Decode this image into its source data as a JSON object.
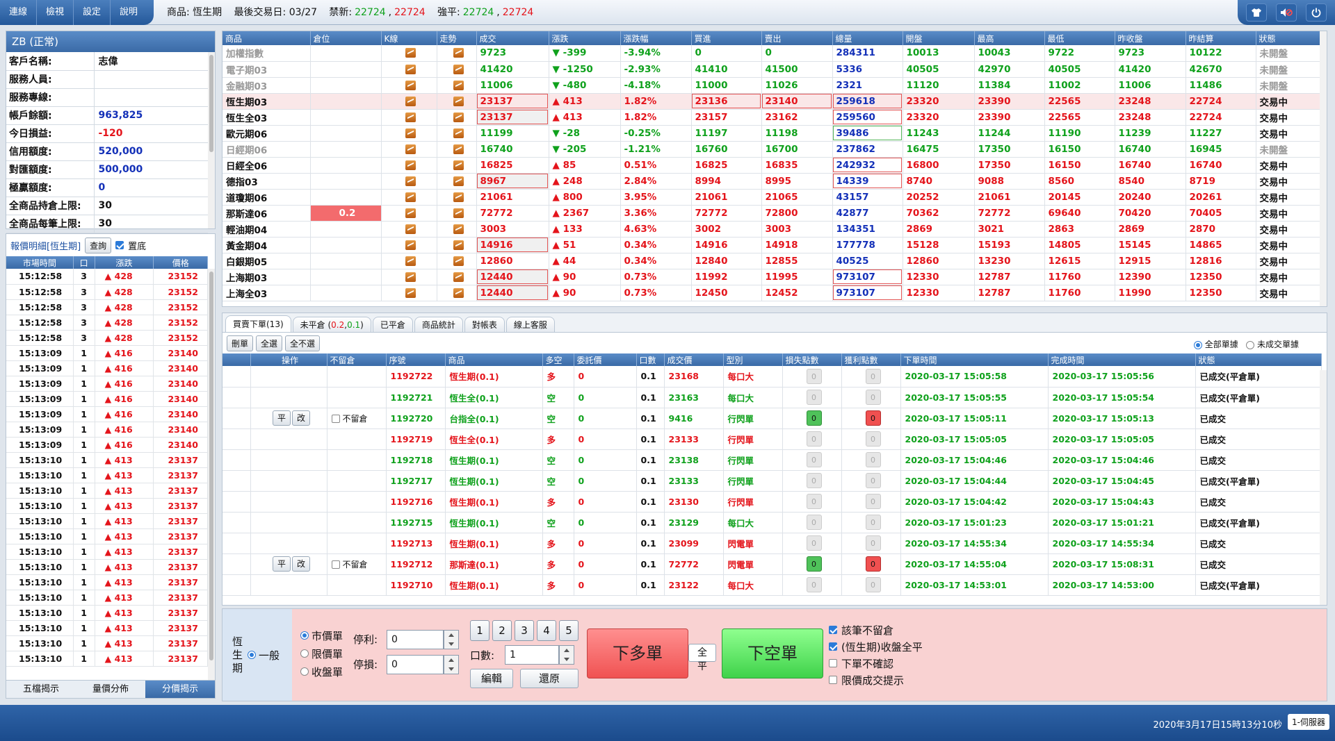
{
  "menu": [
    "連線",
    "檢視",
    "設定",
    "說明"
  ],
  "topinfo": {
    "product": "商品: 恆生期",
    "last_trade": "最後交易日: 03/27",
    "ban_label": "禁新:",
    "ban_buy": "22724",
    "ban_sell": "22724",
    "force_label": "強平:",
    "force_buy": "22724",
    "force_sell": "22724"
  },
  "account": {
    "title": "ZB (正常)",
    "rows": [
      {
        "label": "客戶名稱:",
        "value": "志偉",
        "color": "black"
      },
      {
        "label": "服務人員:",
        "value": "",
        "color": "black"
      },
      {
        "label": "服務專線:",
        "value": "",
        "color": "black"
      },
      {
        "label": "帳戶餘額:",
        "value": "963,825",
        "color": "blue"
      },
      {
        "label": "今日損益:",
        "value": "-120",
        "color": "red"
      },
      {
        "label": "信用額度:",
        "value": "520,000",
        "color": "blue"
      },
      {
        "label": "對匯額度:",
        "value": "500,000",
        "color": "blue"
      },
      {
        "label": "極贏額度:",
        "value": "0",
        "color": "blue"
      },
      {
        "label": "全商品持倉上限:",
        "value": "30",
        "color": "black"
      },
      {
        "label": "全商品每筆上限:",
        "value": "30",
        "color": "black"
      }
    ]
  },
  "tick": {
    "title": "報價明細[恆生期]",
    "query": "查詢",
    "pin": "置底",
    "headers": [
      "市場時間",
      "口",
      "漲跌",
      "價格"
    ],
    "rows": [
      [
        "15:12:58",
        "3",
        "428",
        "23152"
      ],
      [
        "15:12:58",
        "3",
        "428",
        "23152"
      ],
      [
        "15:12:58",
        "3",
        "428",
        "23152"
      ],
      [
        "15:12:58",
        "3",
        "428",
        "23152"
      ],
      [
        "15:12:58",
        "3",
        "428",
        "23152"
      ],
      [
        "15:13:09",
        "1",
        "416",
        "23140"
      ],
      [
        "15:13:09",
        "1",
        "416",
        "23140"
      ],
      [
        "15:13:09",
        "1",
        "416",
        "23140"
      ],
      [
        "15:13:09",
        "1",
        "416",
        "23140"
      ],
      [
        "15:13:09",
        "1",
        "416",
        "23140"
      ],
      [
        "15:13:09",
        "1",
        "416",
        "23140"
      ],
      [
        "15:13:09",
        "1",
        "416",
        "23140"
      ],
      [
        "15:13:10",
        "1",
        "413",
        "23137"
      ],
      [
        "15:13:10",
        "1",
        "413",
        "23137"
      ],
      [
        "15:13:10",
        "1",
        "413",
        "23137"
      ],
      [
        "15:13:10",
        "1",
        "413",
        "23137"
      ],
      [
        "15:13:10",
        "1",
        "413",
        "23137"
      ],
      [
        "15:13:10",
        "1",
        "413",
        "23137"
      ],
      [
        "15:13:10",
        "1",
        "413",
        "23137"
      ],
      [
        "15:13:10",
        "1",
        "413",
        "23137"
      ],
      [
        "15:13:10",
        "1",
        "413",
        "23137"
      ],
      [
        "15:13:10",
        "1",
        "413",
        "23137"
      ],
      [
        "15:13:10",
        "1",
        "413",
        "23137"
      ],
      [
        "15:13:10",
        "1",
        "413",
        "23137"
      ],
      [
        "15:13:10",
        "1",
        "413",
        "23137"
      ],
      [
        "15:13:10",
        "1",
        "413",
        "23137"
      ]
    ],
    "tabs": [
      "五檔揭示",
      "量價分佈",
      "分價揭示"
    ]
  },
  "quote": {
    "headers": [
      "商品",
      "倉位",
      "K線",
      "走勢",
      "成交",
      "漲跌",
      "漲跌幅",
      "買進",
      "賣出",
      "總量",
      "開盤",
      "最高",
      "最低",
      "昨收盤",
      "昨結算",
      "狀態"
    ],
    "rows": [
      {
        "name": "加權指數",
        "pos": "",
        "last": "9723",
        "chg": "-399",
        "pct": "-3.94%",
        "bid": "0",
        "ask": "0",
        "vol": "284311",
        "open": "10013",
        "high": "10043",
        "low": "9722",
        "prev": "9723",
        "settle": "10122",
        "status": "未開盤",
        "dir": "down",
        "active": false
      },
      {
        "name": "電子期03",
        "pos": "",
        "last": "41420",
        "chg": "-1250",
        "pct": "-2.93%",
        "bid": "41410",
        "ask": "41500",
        "vol": "5336",
        "open": "40505",
        "high": "42970",
        "low": "40505",
        "prev": "41420",
        "settle": "42670",
        "status": "未開盤",
        "dir": "down",
        "active": false
      },
      {
        "name": "金融期03",
        "pos": "",
        "last": "11006",
        "chg": "-480",
        "pct": "-4.18%",
        "bid": "11000",
        "ask": "11026",
        "vol": "2321",
        "open": "11120",
        "high": "11384",
        "low": "11002",
        "prev": "11006",
        "settle": "11486",
        "status": "未開盤",
        "dir": "down",
        "active": false
      },
      {
        "name": "恆生期03",
        "pos": "",
        "last": "23137",
        "chg": "413",
        "pct": "1.82%",
        "bid": "23136",
        "ask": "23140",
        "vol": "259618",
        "open": "23320",
        "high": "23390",
        "low": "22565",
        "prev": "23248",
        "settle": "22724",
        "status": "交易中",
        "dir": "up",
        "active": true
      },
      {
        "name": "恆生全03",
        "pos": "",
        "last": "23137",
        "chg": "413",
        "pct": "1.82%",
        "bid": "23157",
        "ask": "23162",
        "vol": "259560",
        "open": "23320",
        "high": "23390",
        "low": "22565",
        "prev": "23248",
        "settle": "22724",
        "status": "交易中",
        "dir": "up",
        "active": true
      },
      {
        "name": "歐元期06",
        "pos": "",
        "last": "11199",
        "chg": "-28",
        "pct": "-0.25%",
        "bid": "11197",
        "ask": "11198",
        "vol": "39486",
        "open": "11243",
        "high": "11244",
        "low": "11190",
        "prev": "11239",
        "settle": "11227",
        "status": "交易中",
        "dir": "down",
        "active": true
      },
      {
        "name": "日經期06",
        "pos": "",
        "last": "16740",
        "chg": "-205",
        "pct": "-1.21%",
        "bid": "16760",
        "ask": "16700",
        "vol": "237862",
        "open": "16475",
        "high": "17350",
        "low": "16150",
        "prev": "16740",
        "settle": "16945",
        "status": "未開盤",
        "dir": "down",
        "active": false
      },
      {
        "name": "日經全06",
        "pos": "",
        "last": "16825",
        "chg": "85",
        "pct": "0.51%",
        "bid": "16825",
        "ask": "16835",
        "vol": "242932",
        "open": "16800",
        "high": "17350",
        "low": "16150",
        "prev": "16740",
        "settle": "16740",
        "status": "交易中",
        "dir": "up",
        "active": true
      },
      {
        "name": "德指03",
        "pos": "",
        "last": "8967",
        "chg": "248",
        "pct": "2.84%",
        "bid": "8994",
        "ask": "8995",
        "vol": "14339",
        "open": "8740",
        "high": "9088",
        "low": "8560",
        "prev": "8540",
        "settle": "8719",
        "status": "交易中",
        "dir": "up",
        "active": true
      },
      {
        "name": "道瓊期06",
        "pos": "",
        "last": "21061",
        "chg": "800",
        "pct": "3.95%",
        "bid": "21061",
        "ask": "21065",
        "vol": "43157",
        "open": "20252",
        "high": "21061",
        "low": "20145",
        "prev": "20240",
        "settle": "20261",
        "status": "交易中",
        "dir": "up",
        "active": true
      },
      {
        "name": "那斯達06",
        "pos": "0.2",
        "last": "72772",
        "chg": "2367",
        "pct": "3.36%",
        "bid": "72772",
        "ask": "72800",
        "vol": "42877",
        "open": "70362",
        "high": "72772",
        "low": "69640",
        "prev": "70420",
        "settle": "70405",
        "status": "交易中",
        "dir": "up",
        "active": true
      },
      {
        "name": "輕油期04",
        "pos": "",
        "last": "3003",
        "chg": "133",
        "pct": "4.63%",
        "bid": "3002",
        "ask": "3003",
        "vol": "134351",
        "open": "2869",
        "high": "3021",
        "low": "2863",
        "prev": "2869",
        "settle": "2870",
        "status": "交易中",
        "dir": "up",
        "active": true
      },
      {
        "name": "黃金期04",
        "pos": "",
        "last": "14916",
        "chg": "51",
        "pct": "0.34%",
        "bid": "14916",
        "ask": "14918",
        "vol": "177778",
        "open": "15128",
        "high": "15193",
        "low": "14805",
        "prev": "15145",
        "settle": "14865",
        "status": "交易中",
        "dir": "up",
        "active": true
      },
      {
        "name": "白銀期05",
        "pos": "",
        "last": "12860",
        "chg": "44",
        "pct": "0.34%",
        "bid": "12840",
        "ask": "12855",
        "vol": "40525",
        "open": "12860",
        "high": "13230",
        "low": "12615",
        "prev": "12915",
        "settle": "12816",
        "status": "交易中",
        "dir": "up",
        "active": true
      },
      {
        "name": "上海期03",
        "pos": "",
        "last": "12440",
        "chg": "90",
        "pct": "0.73%",
        "bid": "11992",
        "ask": "11995",
        "vol": "973107",
        "open": "12330",
        "high": "12787",
        "low": "11760",
        "prev": "12390",
        "settle": "12350",
        "status": "交易中",
        "dir": "up",
        "active": true
      },
      {
        "name": "上海全03",
        "pos": "",
        "last": "12440",
        "chg": "90",
        "pct": "0.73%",
        "bid": "12450",
        "ask": "12452",
        "vol": "973107",
        "open": "12330",
        "high": "12787",
        "low": "11760",
        "prev": "11990",
        "settle": "12350",
        "status": "交易中",
        "dir": "up",
        "active": true
      }
    ]
  },
  "orders": {
    "tabs": [
      "買賣下單(13)",
      "未平倉 (0.2,0.1)",
      "已平倉",
      "商品統計",
      "對帳表",
      "線上客服"
    ],
    "unpos_prefix": "未平倉 (",
    "unpos_a": "0.2",
    "unpos_b": "0.1",
    "buttons": [
      "刪單",
      "全選",
      "全不選"
    ],
    "filter_all": "全部單據",
    "filter_open": "未成交單據",
    "headers": [
      "操作",
      "不留倉",
      "序號",
      "商品",
      "多空",
      "委託價",
      "口數",
      "成交價",
      "型別",
      "損失點數",
      "獲利點數",
      "下單時間",
      "完成時間",
      "狀態"
    ],
    "btn_close": "平",
    "btn_edit": "改",
    "noholdlbl": "不留倉",
    "rows": [
      {
        "ops": false,
        "id": "1192722",
        "prod": "恆生期(0.1)",
        "side": "多",
        "price": "0",
        "qty": "0.1",
        "fill": "23168",
        "type": "每口大",
        "loss": "0",
        "profit": "0",
        "t1": "2020-03-17 15:05:58",
        "t2": "2020-03-17 15:05:56",
        "status": "已成交(平倉單)",
        "color": "red",
        "lc": "g",
        "pc": "g"
      },
      {
        "ops": false,
        "id": "1192721",
        "prod": "恆生全(0.1)",
        "side": "空",
        "price": "0",
        "qty": "0.1",
        "fill": "23163",
        "type": "每口大",
        "loss": "0",
        "profit": "0",
        "t1": "2020-03-17 15:05:55",
        "t2": "2020-03-17 15:05:54",
        "status": "已成交(平倉單)",
        "color": "green",
        "lc": "g",
        "pc": "g"
      },
      {
        "ops": true,
        "id": "1192720",
        "prod": "台指全(0.1)",
        "side": "空",
        "price": "0",
        "qty": "0.1",
        "fill": "9416",
        "type": "行閃單",
        "loss": "0",
        "profit": "0",
        "t1": "2020-03-17 15:05:11",
        "t2": "2020-03-17 15:05:13",
        "status": "已成交",
        "color": "green",
        "lc": "gr",
        "pc": "rd"
      },
      {
        "ops": false,
        "id": "1192719",
        "prod": "恆生全(0.1)",
        "side": "多",
        "price": "0",
        "qty": "0.1",
        "fill": "23133",
        "type": "行閃單",
        "loss": "0",
        "profit": "0",
        "t1": "2020-03-17 15:05:05",
        "t2": "2020-03-17 15:05:05",
        "status": "已成交",
        "color": "red",
        "lc": "g",
        "pc": "g"
      },
      {
        "ops": false,
        "id": "1192718",
        "prod": "恆生期(0.1)",
        "side": "空",
        "price": "0",
        "qty": "0.1",
        "fill": "23138",
        "type": "行閃單",
        "loss": "0",
        "profit": "0",
        "t1": "2020-03-17 15:04:46",
        "t2": "2020-03-17 15:04:46",
        "status": "已成交",
        "color": "green",
        "lc": "g",
        "pc": "g"
      },
      {
        "ops": false,
        "id": "1192717",
        "prod": "恆生期(0.1)",
        "side": "空",
        "price": "0",
        "qty": "0.1",
        "fill": "23133",
        "type": "行閃單",
        "loss": "0",
        "profit": "0",
        "t1": "2020-03-17 15:04:44",
        "t2": "2020-03-17 15:04:45",
        "status": "已成交(平倉單)",
        "color": "green",
        "lc": "g",
        "pc": "g"
      },
      {
        "ops": false,
        "id": "1192716",
        "prod": "恆生期(0.1)",
        "side": "多",
        "price": "0",
        "qty": "0.1",
        "fill": "23130",
        "type": "行閃單",
        "loss": "0",
        "profit": "0",
        "t1": "2020-03-17 15:04:42",
        "t2": "2020-03-17 15:04:43",
        "status": "已成交",
        "color": "red",
        "lc": "g",
        "pc": "g"
      },
      {
        "ops": false,
        "id": "1192715",
        "prod": "恆生期(0.1)",
        "side": "空",
        "price": "0",
        "qty": "0.1",
        "fill": "23129",
        "type": "每口大",
        "loss": "0",
        "profit": "0",
        "t1": "2020-03-17 15:01:23",
        "t2": "2020-03-17 15:01:21",
        "status": "已成交(平倉單)",
        "color": "green",
        "lc": "g",
        "pc": "g"
      },
      {
        "ops": false,
        "id": "1192713",
        "prod": "恆生期(0.1)",
        "side": "多",
        "price": "0",
        "qty": "0.1",
        "fill": "23099",
        "type": "閃電單",
        "loss": "0",
        "profit": "0",
        "t1": "2020-03-17 14:55:34",
        "t2": "2020-03-17 14:55:34",
        "status": "已成交",
        "color": "red",
        "lc": "g",
        "pc": "g"
      },
      {
        "ops": true,
        "id": "1192712",
        "prod": "那斯達(0.1)",
        "side": "多",
        "price": "0",
        "qty": "0.1",
        "fill": "72772",
        "type": "閃電單",
        "loss": "0",
        "profit": "0",
        "t1": "2020-03-17 14:55:04",
        "t2": "2020-03-17 15:08:31",
        "status": "已成交",
        "color": "red",
        "lc": "gr",
        "pc": "rd"
      },
      {
        "ops": false,
        "id": "1192710",
        "prod": "恆生期(0.1)",
        "side": "多",
        "price": "0",
        "qty": "0.1",
        "fill": "23122",
        "type": "每口大",
        "loss": "0",
        "profit": "0",
        "t1": "2020-03-17 14:53:01",
        "t2": "2020-03-17 14:53:00",
        "status": "已成交(平倉單)",
        "color": "red",
        "lc": "g",
        "pc": "g"
      }
    ]
  },
  "entry": {
    "product": "恆生期",
    "mode": "一般",
    "ordertypes": [
      "市價單",
      "限價單",
      "收盤單"
    ],
    "tp_label": "停利:",
    "tp_value": "0",
    "sl_label": "停損:",
    "sl_value": "0",
    "qty_label": "口數:",
    "qty_value": "1",
    "nums": [
      "1",
      "2",
      "3",
      "4",
      "5"
    ],
    "edit": "編輯",
    "reset": "還原",
    "buy": "下多單",
    "flat": "全平",
    "sell": "下空單",
    "options": [
      {
        "label": "該筆不留倉",
        "on": true
      },
      {
        "label": "(恆生期)收盤全平",
        "on": true
      },
      {
        "label": "下單不確認",
        "on": false
      },
      {
        "label": "限價成交提示",
        "on": false
      }
    ]
  },
  "status": {
    "time": "2020年3月17日15時13分10秒",
    "server": "1-伺服器"
  },
  "colors": {
    "up": "#e4141b",
    "down": "#0fa11c",
    "header": "#3a6aa6",
    "entry_bg": "#f9d2d2"
  }
}
